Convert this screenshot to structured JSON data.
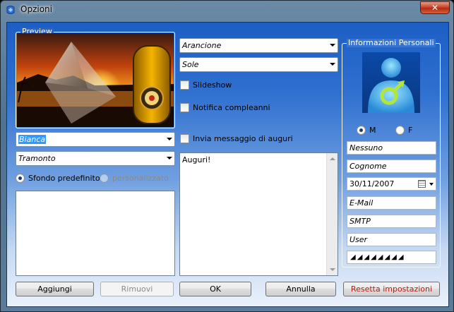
{
  "window": {
    "title": "Opzioni",
    "close_label": "✕"
  },
  "preview": {
    "group_title": "Preview"
  },
  "left": {
    "combo_color": "Bianca",
    "combo_theme": "Tramonto",
    "radio_default_label": "Sfondo predefinito",
    "radio_custom_label": "personalizzato"
  },
  "middle": {
    "combo_color": "Arancione",
    "combo_theme": "Sole",
    "slideshow_label": "Slideshow",
    "birthday_label": "Notifica compleanni",
    "send_greetings_label": "Invia messaggio di auguri",
    "greetings_text": "Auguri!"
  },
  "info": {
    "group_title": "Informazioni Personali",
    "gender_m": "M",
    "gender_f": "F",
    "name": "Nessuno",
    "surname": "Cognome",
    "birthdate": "30/11/2007",
    "email": "E-Mail",
    "smtp": "SMTP",
    "user": "User",
    "password_mask": "◢◢◢◢◢◢◢◢"
  },
  "buttons": {
    "add": "Aggiungi",
    "remove": "Rimuovi",
    "ok": "OK",
    "cancel": "Annulla",
    "reset": "Resetta impostazioni"
  }
}
